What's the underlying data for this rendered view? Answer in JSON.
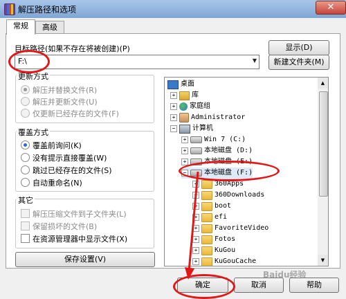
{
  "window": {
    "title": "解压路径和选项",
    "close_label": "✕"
  },
  "tabs": [
    {
      "label": "常规"
    },
    {
      "label": "高级"
    }
  ],
  "target_path": {
    "label": "目标路径(如果不存在将被创建)(P)",
    "value": "F:\\"
  },
  "buttons": {
    "show": "显示(D)",
    "new_folder": "新建文件夹(M)",
    "save_settings": "保存设置(V)",
    "ok": "确定",
    "cancel": "取消",
    "help": "帮助"
  },
  "update_mode": {
    "title": "更新方式",
    "options": [
      "解压并替换文件(R)",
      "解压并更新文件(U)",
      "仅更新已经存在的文件(F)"
    ],
    "selected_index": 0
  },
  "overwrite_mode": {
    "title": "覆盖方式",
    "options": [
      "覆盖前询问(K)",
      "没有提示直接覆盖(W)",
      "跳过已经存在的文件(S)",
      "自动重命名(N)"
    ],
    "selected_index": 0
  },
  "misc": {
    "title": "其它",
    "options": [
      "解压压缩文件到子文件夹(L)",
      "保留损坏的文件(B)",
      "在资源管理器中显示文件(X)"
    ]
  },
  "tree": {
    "nodes": [
      {
        "label": "桌面"
      },
      {
        "label": "库"
      },
      {
        "label": "家庭组"
      },
      {
        "label": "Administrator"
      },
      {
        "label": "计算机"
      },
      {
        "label": "Win 7 (C:)"
      },
      {
        "label": "本地磁盘 (D:)"
      },
      {
        "label": "本地磁盘 (E:)"
      },
      {
        "label": "本地磁盘 (F:)"
      },
      {
        "label": "360Apps"
      },
      {
        "label": "360Downloads"
      },
      {
        "label": "boot"
      },
      {
        "label": "efi"
      },
      {
        "label": "FavoriteVideo"
      },
      {
        "label": "Fotos"
      },
      {
        "label": "KuGou"
      },
      {
        "label": "KuGouCache"
      }
    ]
  },
  "watermark": "Baidu经验",
  "icons": {
    "close": "close-icon",
    "dropdown": "chevron-down-icon",
    "desktop": "desktop-icon",
    "library": "library-icon",
    "homegroup": "homegroup-icon",
    "user": "user-icon",
    "computer": "computer-icon",
    "drive": "drive-icon",
    "folder": "folder-icon"
  },
  "colors": {
    "annotation_red": "#e01818",
    "selection": "#dfeaf8",
    "title_bar": "#8fb2d8"
  }
}
